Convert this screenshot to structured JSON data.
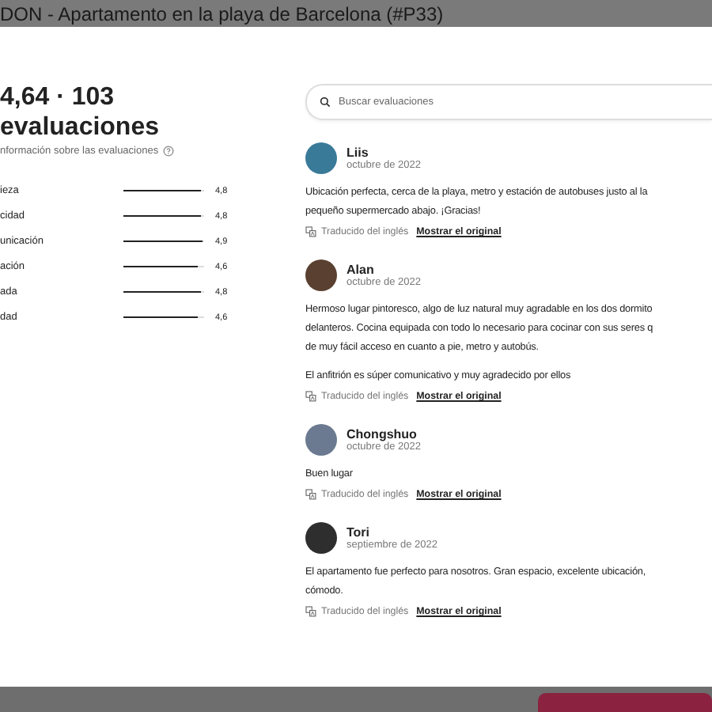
{
  "window": {
    "title": "DON - Apartamento en la playa de Barcelona (#P33)"
  },
  "summary": {
    "rating": "4,64 · 103",
    "heading": "evaluaciones",
    "info_link": "nformación sobre las evaluaciones"
  },
  "categories": [
    {
      "label": "ieza",
      "level": 0.96,
      "reading": "4,8"
    },
    {
      "label": "cidad",
      "level": 0.96,
      "reading": "4,8"
    },
    {
      "label": "unicación",
      "level": 0.98,
      "reading": "4,9"
    },
    {
      "label": "ación",
      "level": 0.92,
      "reading": "4,6"
    },
    {
      "label": "ada",
      "level": 0.96,
      "reading": "4,8"
    },
    {
      "label": "dad",
      "level": 0.92,
      "reading": "4,6"
    }
  ],
  "search": {
    "placeholder": "Buscar evaluaciones"
  },
  "reviews": [
    {
      "name": "Liis",
      "date": "octubre de 2022",
      "paragraphs": [
        [
          "Ubicación perfecta, cerca de la playa, metro y estación de autobuses justo al la",
          "pequeño supermercado abajo. ¡Gracias!"
        ]
      ],
      "translation": "Traducido del inglés",
      "link": "Mostrar el original"
    },
    {
      "name": "Alan",
      "date": "octubre de 2022",
      "paragraphs": [
        [
          "Hermoso lugar pintoresco, algo de luz natural muy agradable en los dos dormito",
          "delanteros. Cocina equipada con todo lo necesario para cocinar con sus seres q",
          "de muy fácil acceso en cuanto a pie, metro y autobús."
        ],
        [
          "El anfitrión es súper comunicativo y muy agradecido por ellos"
        ]
      ],
      "translation": "Traducido del inglés",
      "link": "Mostrar el original"
    },
    {
      "name": "Chongshuo",
      "date": "octubre de 2022",
      "paragraphs": [
        [
          "Buen lugar"
        ]
      ],
      "translation": "Traducido del inglés",
      "link": "Mostrar el original"
    },
    {
      "name": "Tori",
      "date": "septiembre de 2022",
      "paragraphs": [
        [
          "El apartamento fue perfecto para nosotros. Gran espacio, excelente ubicación,",
          "cómodo."
        ]
      ],
      "translation": "Traducido del inglés",
      "link": "Mostrar el original"
    }
  ]
}
